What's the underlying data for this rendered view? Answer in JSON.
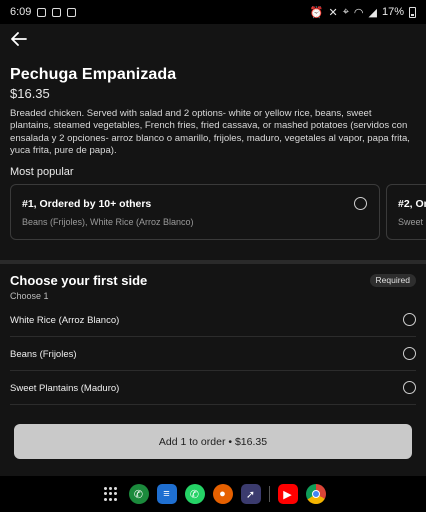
{
  "status_bar": {
    "time": "6:09",
    "battery": "17%"
  },
  "item": {
    "title": "Pechuga Empanizada",
    "price": "$16.35",
    "description": "Breaded chicken. Served with salad and 2 options- white or yellow rice, beans, sweet plantains, steamed vegetables, French fries, fried cassava, or mashed potatoes (servidos con ensalada y 2 opciones- arroz blanco o amarillo, frijoles, maduro, vegetales al vapor, papa frita, yuca frita, pure de papa)."
  },
  "most_popular": {
    "label": "Most popular",
    "cards": [
      {
        "title": "#1, Ordered by 10+ others",
        "subtitle": "Beans (Frijoles), White Rice (Arroz Blanco)"
      },
      {
        "title": "#2, Or",
        "subtitle": "Sweet P"
      }
    ]
  },
  "first_side": {
    "title": "Choose your first side",
    "badge": "Required",
    "count": "Choose 1",
    "options": [
      {
        "label": "White Rice (Arroz Blanco)"
      },
      {
        "label": "Beans (Frijoles)"
      },
      {
        "label": "Sweet Plantains (Maduro)"
      }
    ]
  },
  "add_button": {
    "label": "Add 1 to order • $16.35"
  },
  "dock": {
    "apps": [
      "apps-grid-icon",
      "phone-icon",
      "messages-icon",
      "whatsapp-icon",
      "firefox-icon",
      "rocket-app-icon",
      "youtube-icon",
      "chrome-icon"
    ]
  },
  "colors": {
    "background": "#141414",
    "button": "#c9c9c9",
    "youtube": "#ff0000",
    "whatsapp": "#25d366",
    "phone": "#1b8a3c"
  }
}
